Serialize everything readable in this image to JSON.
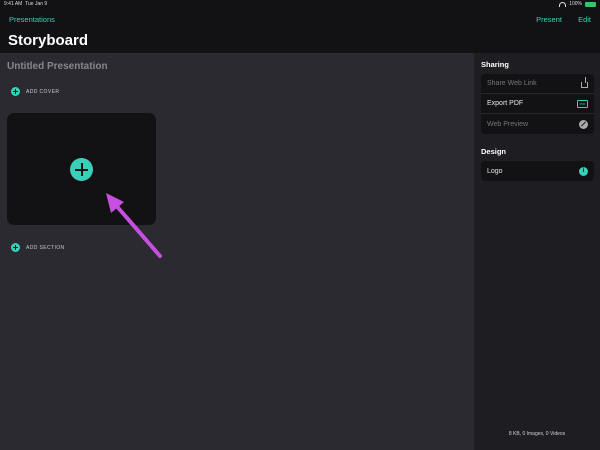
{
  "status": {
    "time": "9:41 AM",
    "date": "Tue Jan 9",
    "battery": "100%",
    "battery_icon": "battery-icon",
    "wifi_icon": "wifi-icon"
  },
  "nav": {
    "back_label": "Presentations",
    "title": "Storyboard",
    "present_label": "Present",
    "edit_label": "Edit"
  },
  "main": {
    "presentation_title": "Untitled Presentation",
    "add_cover_label": "ADD COVER",
    "add_section_label": "ADD SECTION"
  },
  "sidebar": {
    "sharing_title": "Sharing",
    "sharing_items": [
      {
        "label": "Share Web Link",
        "enabled": false,
        "icon": "share-icon"
      },
      {
        "label": "Export PDF",
        "enabled": true,
        "icon": "pdf-icon"
      },
      {
        "label": "Web Preview",
        "enabled": false,
        "icon": "compass-icon"
      }
    ],
    "pdf_badge": "PDF",
    "design_title": "Design",
    "design_items": [
      {
        "label": "Logo",
        "icon": "logo-icon"
      }
    ],
    "footer_stats": "8 KB, 0 Images, 0 Videos"
  },
  "colors": {
    "accent": "#3ccfb8",
    "annotation_arrow": "#c64fe0",
    "background": "#2b2a31",
    "sidebar": "#1e1e22"
  }
}
